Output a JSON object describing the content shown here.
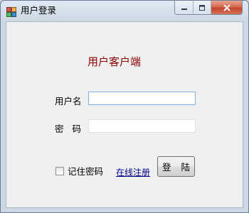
{
  "window": {
    "title": "用户登录",
    "controls": {
      "minimize": "minimize-icon",
      "maximize": "maximize-icon",
      "close": "close-icon"
    }
  },
  "form": {
    "heading": "用户客户端",
    "username_label": "用户名",
    "username_value": "",
    "password_label": "密 码",
    "password_value": "",
    "remember_label": "记住密码",
    "remember_checked": false,
    "register_link": "在线注册",
    "login_button": "登 陆"
  },
  "colors": {
    "heading": "#8b0000",
    "link": "#00008b",
    "close_button": "#c4452b",
    "focused_border": "#7eb4ea"
  }
}
